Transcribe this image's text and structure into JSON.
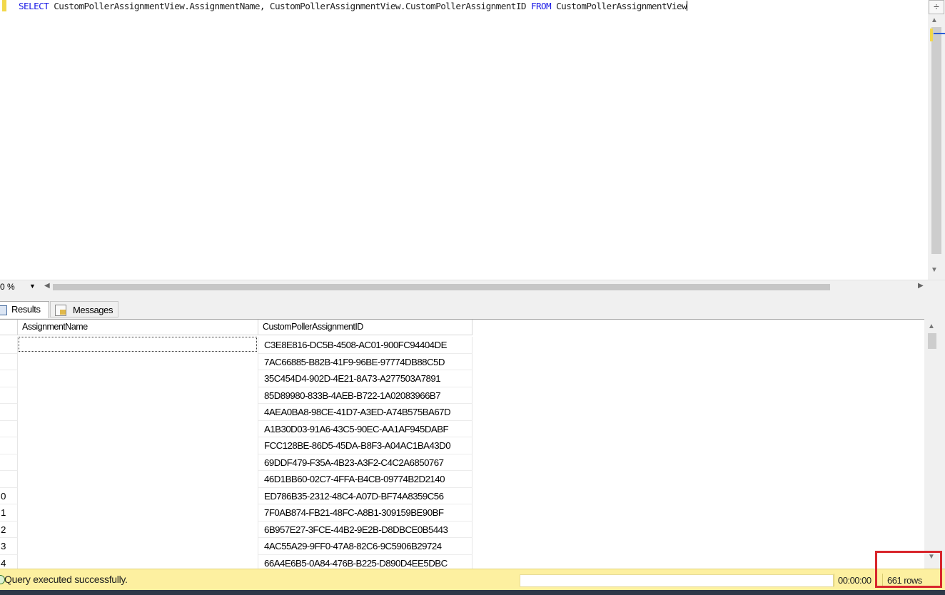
{
  "editor": {
    "sql": {
      "kw_select": "SELECT",
      "columns": " CustomPollerAssignmentView.AssignmentName, CustomPollerAssignmentView.CustomPollerAssignmentID ",
      "kw_from": "FROM",
      "table": " CustomPollerAssignmentView"
    },
    "colors": {
      "keyword": "#1a1ae6",
      "line_marker": "#f2d84a"
    }
  },
  "zoom": {
    "value": "0 %"
  },
  "tabs": {
    "results": "Results",
    "messages": "Messages"
  },
  "grid": {
    "columns": [
      "AssignmentName",
      "CustomPollerAssignmentID"
    ],
    "rows": [
      {
        "num": "",
        "name": "",
        "id": "C3E8E816-DC5B-4508-AC01-900FC94404DE"
      },
      {
        "num": "",
        "name": "",
        "id": "7AC66885-B82B-41F9-96BE-97774DB88C5D"
      },
      {
        "num": "",
        "name": "",
        "id": "35C454D4-902D-4E21-8A73-A277503A7891"
      },
      {
        "num": "",
        "name": "",
        "id": "85D89980-833B-4AEB-B722-1A02083966B7"
      },
      {
        "num": "",
        "name": "",
        "id": "4AEA0BA8-98CE-41D7-A3ED-A74B575BA67D"
      },
      {
        "num": "",
        "name": "",
        "id": "A1B30D03-91A6-43C5-90EC-AA1AF945DABF"
      },
      {
        "num": "",
        "name": "",
        "id": "FCC128BE-86D5-45DA-B8F3-A04AC1BA43D0"
      },
      {
        "num": "",
        "name": "",
        "id": "69DDF479-F35A-4B23-A3F2-C4C2A6850767"
      },
      {
        "num": "",
        "name": "",
        "id": "46D1BB60-02C7-4FFA-B4CB-09774B2D2140"
      },
      {
        "num": "0",
        "name": "",
        "id": "ED786B35-2312-48C4-A07D-BF74A8359C56"
      },
      {
        "num": "1",
        "name": "",
        "id": "7F0AB874-FB21-48FC-A8B1-309159BE90BF"
      },
      {
        "num": "2",
        "name": "",
        "id": "6B957E27-3FCE-44B2-9E2B-D8DBCE0B5443"
      },
      {
        "num": "3",
        "name": "",
        "id": "4AC55A29-9FF0-47A8-82C6-9C5906B29724"
      },
      {
        "num": "4",
        "name": "",
        "id": "66A4E6B5-0A84-476B-B225-D890D4EE5DBC"
      }
    ]
  },
  "status": {
    "message": "Query executed successfully.",
    "elapsed": "00:00:00",
    "rows": "661 rows",
    "colors": {
      "bar": "#fdf0a0",
      "highlight": "#d8262c"
    }
  }
}
